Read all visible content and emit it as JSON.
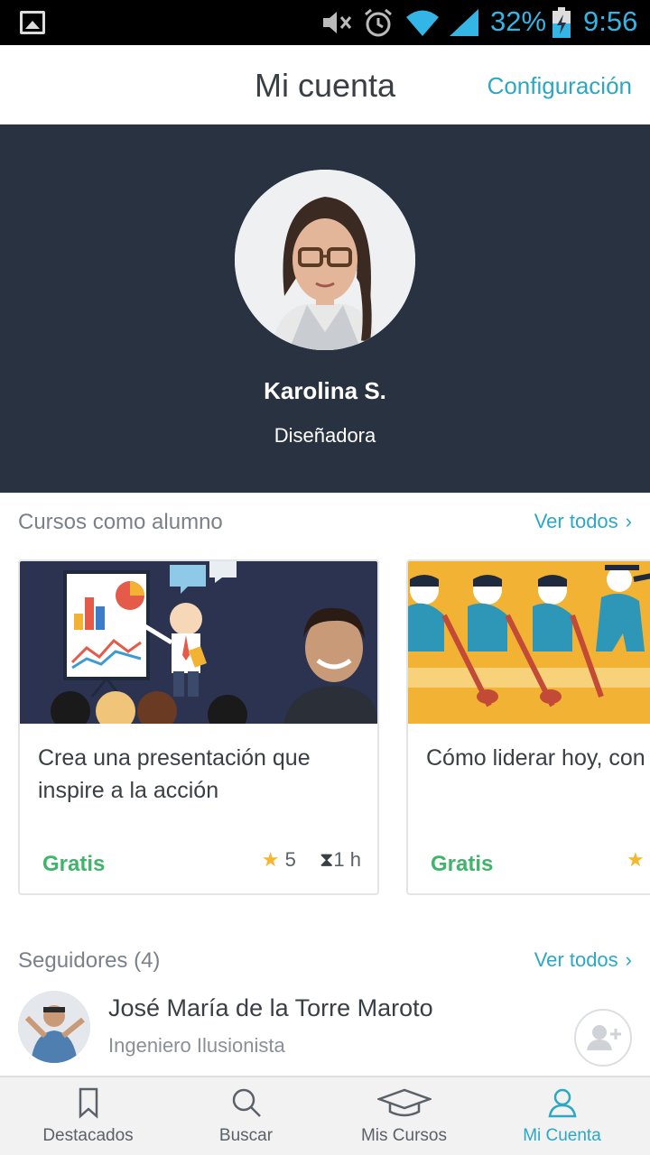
{
  "status_bar": {
    "battery": "32%",
    "time": "9:56",
    "icons": [
      "gallery-icon",
      "mute-icon",
      "alarm-icon",
      "wifi-icon",
      "signal-icon",
      "battery-charging-icon"
    ]
  },
  "header": {
    "title": "Mi cuenta",
    "settings_label": "Configuración"
  },
  "profile": {
    "name": "Karolina S.",
    "role": "Diseñadora"
  },
  "courses_section": {
    "title": "Cursos como alumno",
    "see_all": "Ver todos",
    "cards": [
      {
        "title": "Crea una presentación que inspire a la acción",
        "price": "Gratis",
        "rating": "5",
        "duration": "1 h"
      },
      {
        "title": "Cómo liderar hoy, con conversaciones",
        "price": "Gratis",
        "rating": "",
        "duration": ""
      }
    ]
  },
  "followers_section": {
    "title": "Seguidores (4)",
    "see_all": "Ver todos",
    "items": [
      {
        "name": "José María de la Torre Maroto",
        "job": "Ingeniero Ilusionista"
      }
    ]
  },
  "bottom_nav": {
    "items": [
      {
        "label": "Destacados",
        "icon": "bookmark-icon"
      },
      {
        "label": "Buscar",
        "icon": "search-icon"
      },
      {
        "label": "Mis Cursos",
        "icon": "graduation-cap-icon"
      },
      {
        "label": "Mi Cuenta",
        "icon": "user-icon",
        "active": true
      }
    ]
  },
  "colors": {
    "accent": "#2ca7c4",
    "profile_bg": "#283241",
    "price_green": "#3fb56a",
    "star": "#f5b731"
  }
}
